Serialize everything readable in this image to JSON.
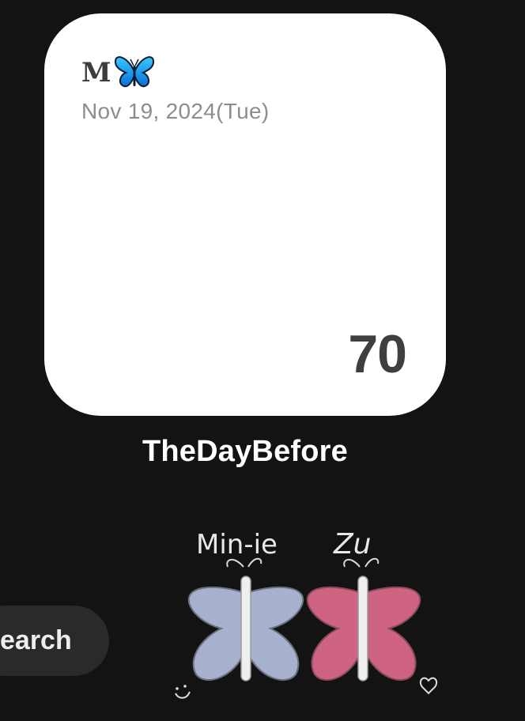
{
  "widget": {
    "title": "M",
    "title_icon": "butterfly-icon",
    "date": "Nov 19, 2024(Tue)",
    "count": "70"
  },
  "app": {
    "label": "TheDayBefore"
  },
  "search": {
    "label": "earch"
  },
  "wallpaper": {
    "left_name": "Min-ie",
    "right_name": "Zu",
    "colors": {
      "left_wing": "#a7b0cc",
      "right_wing": "#cf6482",
      "background": "#131313"
    }
  }
}
